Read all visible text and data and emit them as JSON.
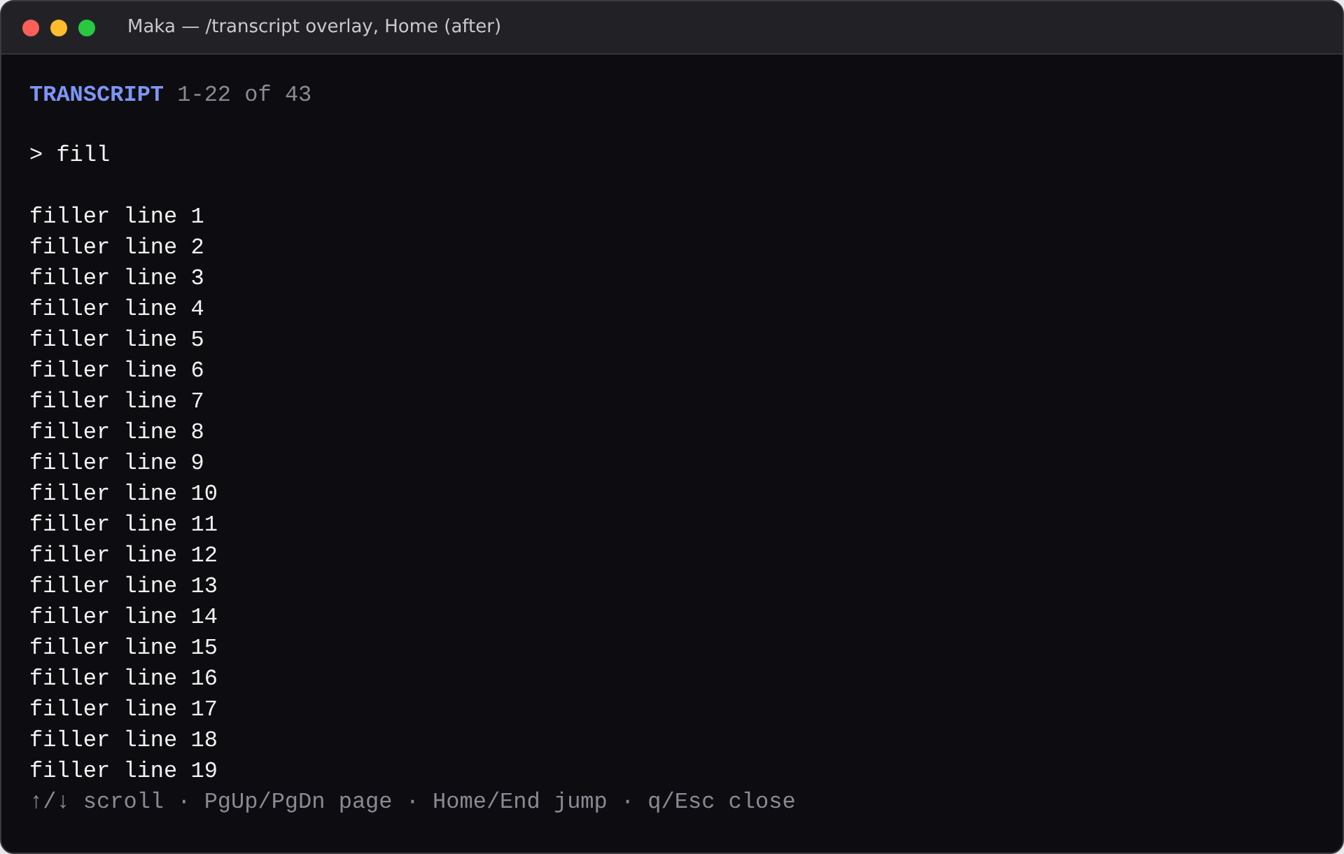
{
  "window": {
    "title": "Maka — /transcript overlay, Home (after)"
  },
  "header": {
    "title": "TRANSCRIPT",
    "range": "1-22 of 43"
  },
  "prompt": "> fill",
  "lines": [
    "filler line 1",
    "filler line 2",
    "filler line 3",
    "filler line 4",
    "filler line 5",
    "filler line 6",
    "filler line 7",
    "filler line 8",
    "filler line 9",
    "filler line 10",
    "filler line 11",
    "filler line 12",
    "filler line 13",
    "filler line 14",
    "filler line 15",
    "filler line 16",
    "filler line 17",
    "filler line 18",
    "filler line 19"
  ],
  "footer": "↑/↓ scroll · PgUp/PgDn page · Home/End jump · q/Esc close"
}
